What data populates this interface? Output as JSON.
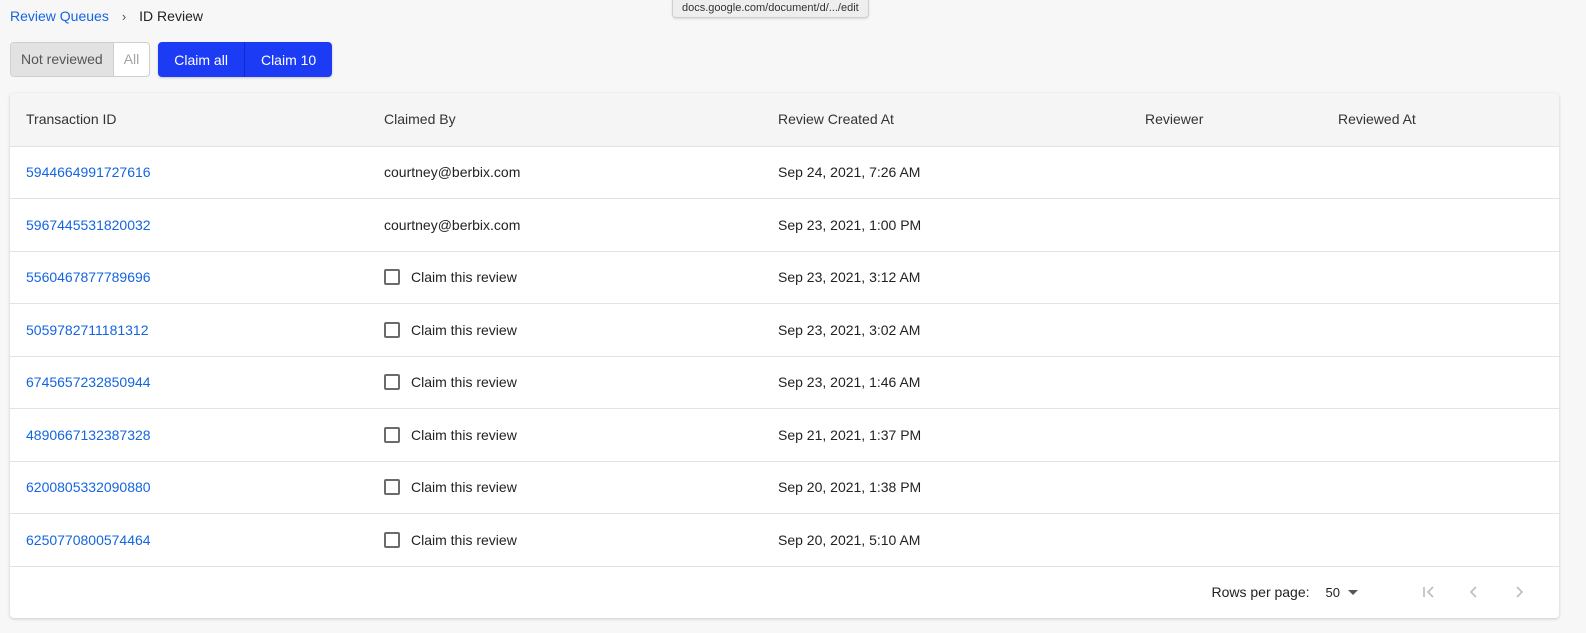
{
  "breadcrumb": {
    "parent": "Review Queues",
    "current": "ID Review"
  },
  "url_tooltip": "docs.google.com/document/d/.../edit",
  "filter": {
    "not_reviewed": "Not reviewed",
    "all": "All"
  },
  "actions": {
    "claim_all": "Claim all",
    "claim_10": "Claim 10"
  },
  "table": {
    "headers": [
      "Transaction ID",
      "Claimed By",
      "Review Created At",
      "Reviewer",
      "Reviewed At"
    ],
    "rows": [
      {
        "id": "5944664991727616",
        "claimed_by": "courtney@berbix.com",
        "created": "Sep 24, 2021, 7:26 AM"
      },
      {
        "id": "5967445531820032",
        "claimed_by": "courtney@berbix.com",
        "created": "Sep 23, 2021, 1:00 PM"
      },
      {
        "id": "5560467877789696",
        "claim_label": "Claim this review",
        "created": "Sep 23, 2021, 3:12 AM"
      },
      {
        "id": "5059782711181312",
        "claim_label": "Claim this review",
        "created": "Sep 23, 2021, 3:02 AM"
      },
      {
        "id": "6745657232850944",
        "claim_label": "Claim this review",
        "created": "Sep 23, 2021, 1:46 AM"
      },
      {
        "id": "4890667132387328",
        "claim_label": "Claim this review",
        "created": "Sep 21, 2021, 1:37 PM"
      },
      {
        "id": "6200805332090880",
        "claim_label": "Claim this review",
        "created": "Sep 20, 2021, 1:38 PM"
      },
      {
        "id": "6250770800574464",
        "claim_label": "Claim this review",
        "created": "Sep 20, 2021, 5:10 AM"
      }
    ]
  },
  "pagination": {
    "rows_per_page_label": "Rows per page:",
    "rows_per_page_value": "50",
    "icons": [
      "first-page-icon",
      "previous-page-icon",
      "next-page-icon"
    ]
  },
  "colors": {
    "link": "#1565e0",
    "primary_button": "#1b3bf5"
  }
}
